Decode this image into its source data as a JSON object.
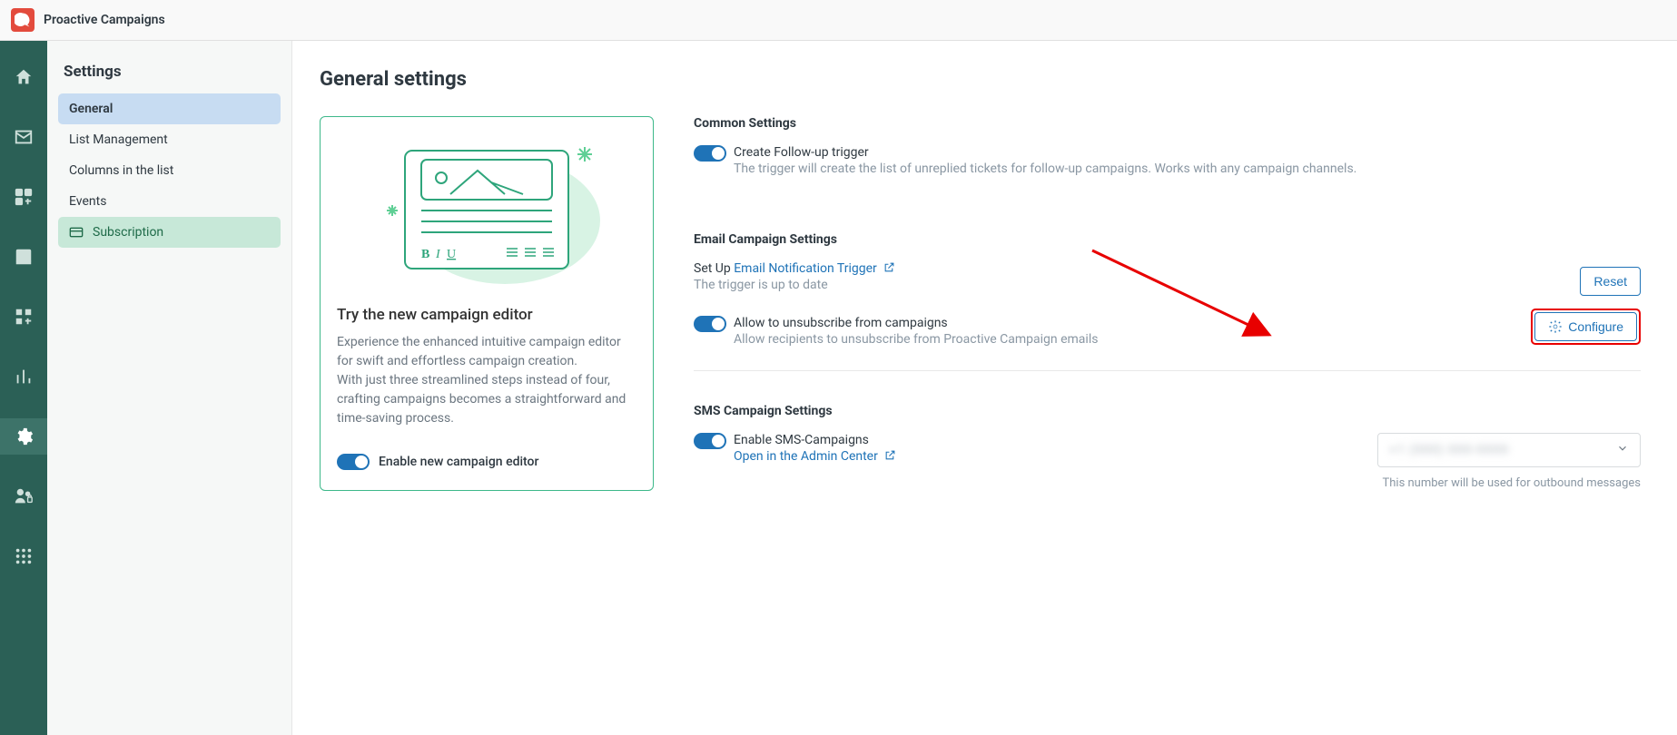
{
  "app": {
    "title": "Proactive Campaigns"
  },
  "sidebar": {
    "heading": "Settings",
    "items": [
      {
        "label": "General"
      },
      {
        "label": "List Management"
      },
      {
        "label": "Columns in the list"
      },
      {
        "label": "Events"
      },
      {
        "label": "Subscription"
      }
    ]
  },
  "main": {
    "heading": "General settings",
    "promo": {
      "title": "Try the new campaign editor",
      "body1": "Experience the enhanced intuitive campaign editor for swift and effortless campaign creation.",
      "body2": "With just three streamlined steps instead of four, crafting campaigns becomes a straightforward and time-saving process.",
      "toggle_label": "Enable new campaign editor"
    },
    "common": {
      "title": "Common Settings",
      "followup_label": "Create Follow-up trigger",
      "followup_desc": "The trigger will create the list of unreplied tickets for follow-up campaigns. Works with any campaign channels."
    },
    "email": {
      "title": "Email Campaign Settings",
      "setup_prefix": "Set Up ",
      "setup_link": "Email Notification Trigger",
      "setup_status": "The trigger is up to date",
      "unsub_label": "Allow to unsubscribe from campaigns",
      "unsub_desc": "Allow recipients to unsubscribe from Proactive Campaign emails",
      "reset_button": "Reset",
      "configure_button": "Configure"
    },
    "sms": {
      "title": "SMS Campaign Settings",
      "enable_label": "Enable SMS-Campaigns",
      "admin_link": "Open in the Admin Center",
      "phone_placeholder": "+1 (000) 000-0000",
      "phone_help": "This number will be used for outbound messages"
    }
  }
}
